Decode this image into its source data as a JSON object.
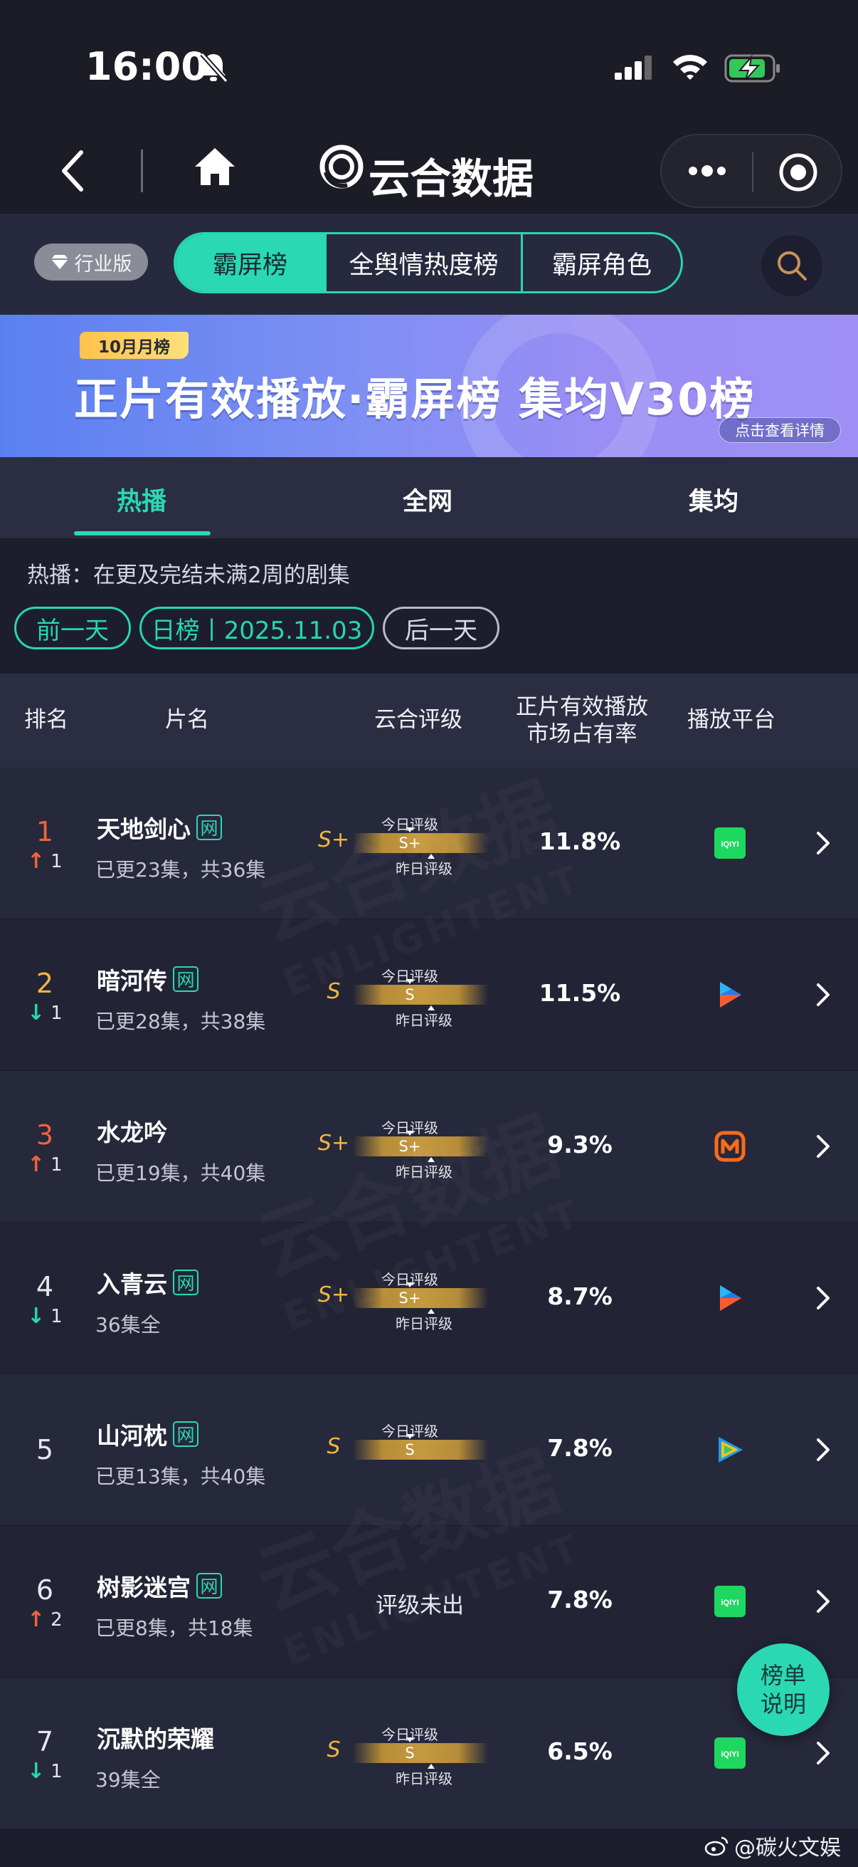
{
  "status_bar": {
    "time": "16:00"
  },
  "nav": {
    "title": "云合数据"
  },
  "top_tabs": {
    "industry_label": "行业版",
    "segments": [
      "霸屏榜",
      "全舆情热度榜",
      "霸屏角色"
    ]
  },
  "banner": {
    "tag": "10月月榜",
    "title": "正片有效播放·霸屏榜 集均V30榜",
    "link": "点击查看详情"
  },
  "sub_tabs": [
    "热播",
    "全网",
    "集均"
  ],
  "description": "热播：在更及完结未满2周的剧集",
  "date_nav": {
    "prev": "前一天",
    "date": "日榜丨2025.11.03",
    "next": "后一天"
  },
  "table_header": {
    "rank": "排名",
    "name": "片名",
    "rating": "云合评级",
    "share_line1": "正片有效播放",
    "share_line2": "市场占有率",
    "platform": "播放平台"
  },
  "gauge_labels": {
    "today": "今日评级",
    "yesterday": "昨日评级"
  },
  "unrated_text": "评级未出",
  "rows": [
    {
      "rank": "1",
      "change": "1",
      "direction": "up",
      "title": "天地剑心",
      "net": "网",
      "episodes": "已更23集，共36集",
      "grade": "S+",
      "today": "S+",
      "share": "11.8%",
      "platform": "iqiyi"
    },
    {
      "rank": "2",
      "change": "1",
      "direction": "down",
      "title": "暗河传",
      "net": "网",
      "episodes": "已更28集，共38集",
      "grade": "S",
      "today": "S",
      "share": "11.5%",
      "platform": "youku"
    },
    {
      "rank": "3",
      "change": "1",
      "direction": "up",
      "title": "水龙吟",
      "net": "",
      "episodes": "已更19集，共40集",
      "grade": "S+",
      "today": "S+",
      "share": "9.3%",
      "platform": "mango"
    },
    {
      "rank": "4",
      "change": "1",
      "direction": "down",
      "title": "入青云",
      "net": "网",
      "episodes": "36集全",
      "grade": "S+",
      "today": "S+",
      "share": "8.7%",
      "platform": "youku"
    },
    {
      "rank": "5",
      "change": "",
      "direction": "none",
      "title": "山河枕",
      "net": "网",
      "episodes": "已更13集，共40集",
      "grade": "S",
      "today": "S",
      "share": "7.8%",
      "platform": "tencent"
    },
    {
      "rank": "6",
      "change": "2",
      "direction": "up",
      "title": "树影迷宫",
      "net": "网",
      "episodes": "已更8集，共18集",
      "grade": "",
      "today": "",
      "share": "7.8%",
      "platform": "iqiyi"
    },
    {
      "rank": "7",
      "change": "1",
      "direction": "down",
      "title": "沉默的荣耀",
      "net": "",
      "episodes": "39集全",
      "grade": "S",
      "today": "S",
      "share": "6.5%",
      "platform": "iqiyi"
    }
  ],
  "platform_labels": {
    "iqiyi": "iQIYI"
  },
  "float_button": {
    "line1": "榜单",
    "line2": "说明"
  },
  "watermark": {
    "main": "云合数据",
    "sub": "ENLIGHTENT"
  },
  "weibo_credit": "@碳火文娱",
  "colors": {
    "accent": "#2ad8b4",
    "up": "#f0643a",
    "down": "#27d6b2",
    "gold": "#f2b540",
    "bg": "#1c1e2e"
  }
}
